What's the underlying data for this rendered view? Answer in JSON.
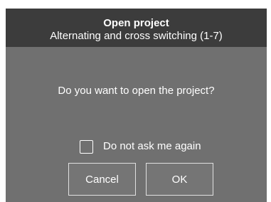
{
  "dialog": {
    "title": "Open project",
    "subtitle": "Alternating and cross switching (1-7)",
    "message": "Do you want to open the project?",
    "checkbox": {
      "label": "Do not ask me again",
      "checked": false
    },
    "buttons": {
      "cancel_label": "Cancel",
      "ok_label": "OK"
    }
  },
  "colors": {
    "titlebar": "#3c3c3c",
    "dialog_body": "#707070",
    "text": "#ffffff",
    "button_border": "#e0e0e0"
  }
}
